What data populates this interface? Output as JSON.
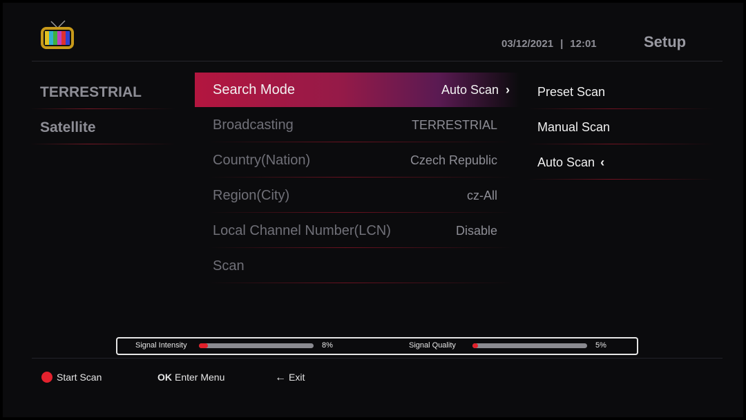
{
  "header": {
    "date": "03/12/2021",
    "separator": "|",
    "time": "12:01",
    "title": "Setup",
    "logo_icon": "tv-icon"
  },
  "left_nav": [
    {
      "label": "TERRESTRIAL"
    },
    {
      "label": "Satellite"
    }
  ],
  "menu": [
    {
      "label": "Search Mode",
      "value": "Auto Scan",
      "chevron": "›"
    },
    {
      "label": "Broadcasting",
      "value": "TERRESTRIAL"
    },
    {
      "label": "Country(Nation)",
      "value": "Czech Republic"
    },
    {
      "label": "Region(City)",
      "value": "cz-All"
    },
    {
      "label": "Local Channel Number(LCN)",
      "value": "Disable"
    },
    {
      "label": "Scan",
      "value": ""
    }
  ],
  "submenu": [
    {
      "label": "Preset Scan"
    },
    {
      "label": "Manual Scan"
    },
    {
      "label": "Auto Scan",
      "chevron": "‹"
    }
  ],
  "signal": {
    "intensity_label": "Signal Intensity",
    "intensity_value": "8%",
    "intensity_fraction": 0.08,
    "quality_label": "Signal Quality",
    "quality_value": "5%",
    "quality_fraction": 0.05
  },
  "footer": {
    "start_scan": "Start Scan",
    "ok_key": "OK",
    "enter_menu": "Enter Menu",
    "exit_arrow": "←",
    "exit": "Exit"
  },
  "colors": {
    "accent": "#b3163f",
    "red_button": "#e3222e",
    "background": "#0b0b0d"
  }
}
